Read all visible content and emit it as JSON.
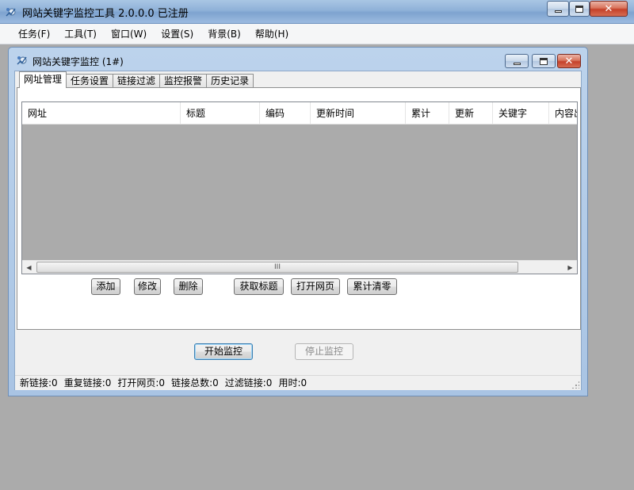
{
  "app": {
    "title": "网站关键字监控工具 2.0.0.0  已注册"
  },
  "menu": [
    "任务(F)",
    "工具(T)",
    "窗口(W)",
    "设置(S)",
    "背景(B)",
    "帮助(H)"
  ],
  "child": {
    "title": "网站关键字监控  (1#)"
  },
  "tabs": [
    "网址管理",
    "任务设置",
    "链接过滤",
    "监控报警",
    "历史记录"
  ],
  "active_tab": 0,
  "list": {
    "columns": [
      "网址",
      "标题",
      "编码",
      "更新时间",
      "累计",
      "更新",
      "关键字",
      "内容出"
    ],
    "rows": [],
    "scroll_grip": "III"
  },
  "buttons": {
    "add": "添加",
    "edit": "修改",
    "delete": "删除",
    "fetch_title": "获取标题",
    "open_page": "打开网页",
    "reset_count": "累计清零",
    "start": "开始监控",
    "stop": "停止监控"
  },
  "status": {
    "new_links": "新链接:0",
    "dup_links": "重复链接:0",
    "opened": "打开网页:0",
    "total": "链接总数:0",
    "filtered": "过滤链接:0",
    "elapsed": "用时:0"
  },
  "colors": {
    "mdi_background": "#ababab",
    "titlebar": "#8fb1d8",
    "close_button": "#c5412a"
  }
}
